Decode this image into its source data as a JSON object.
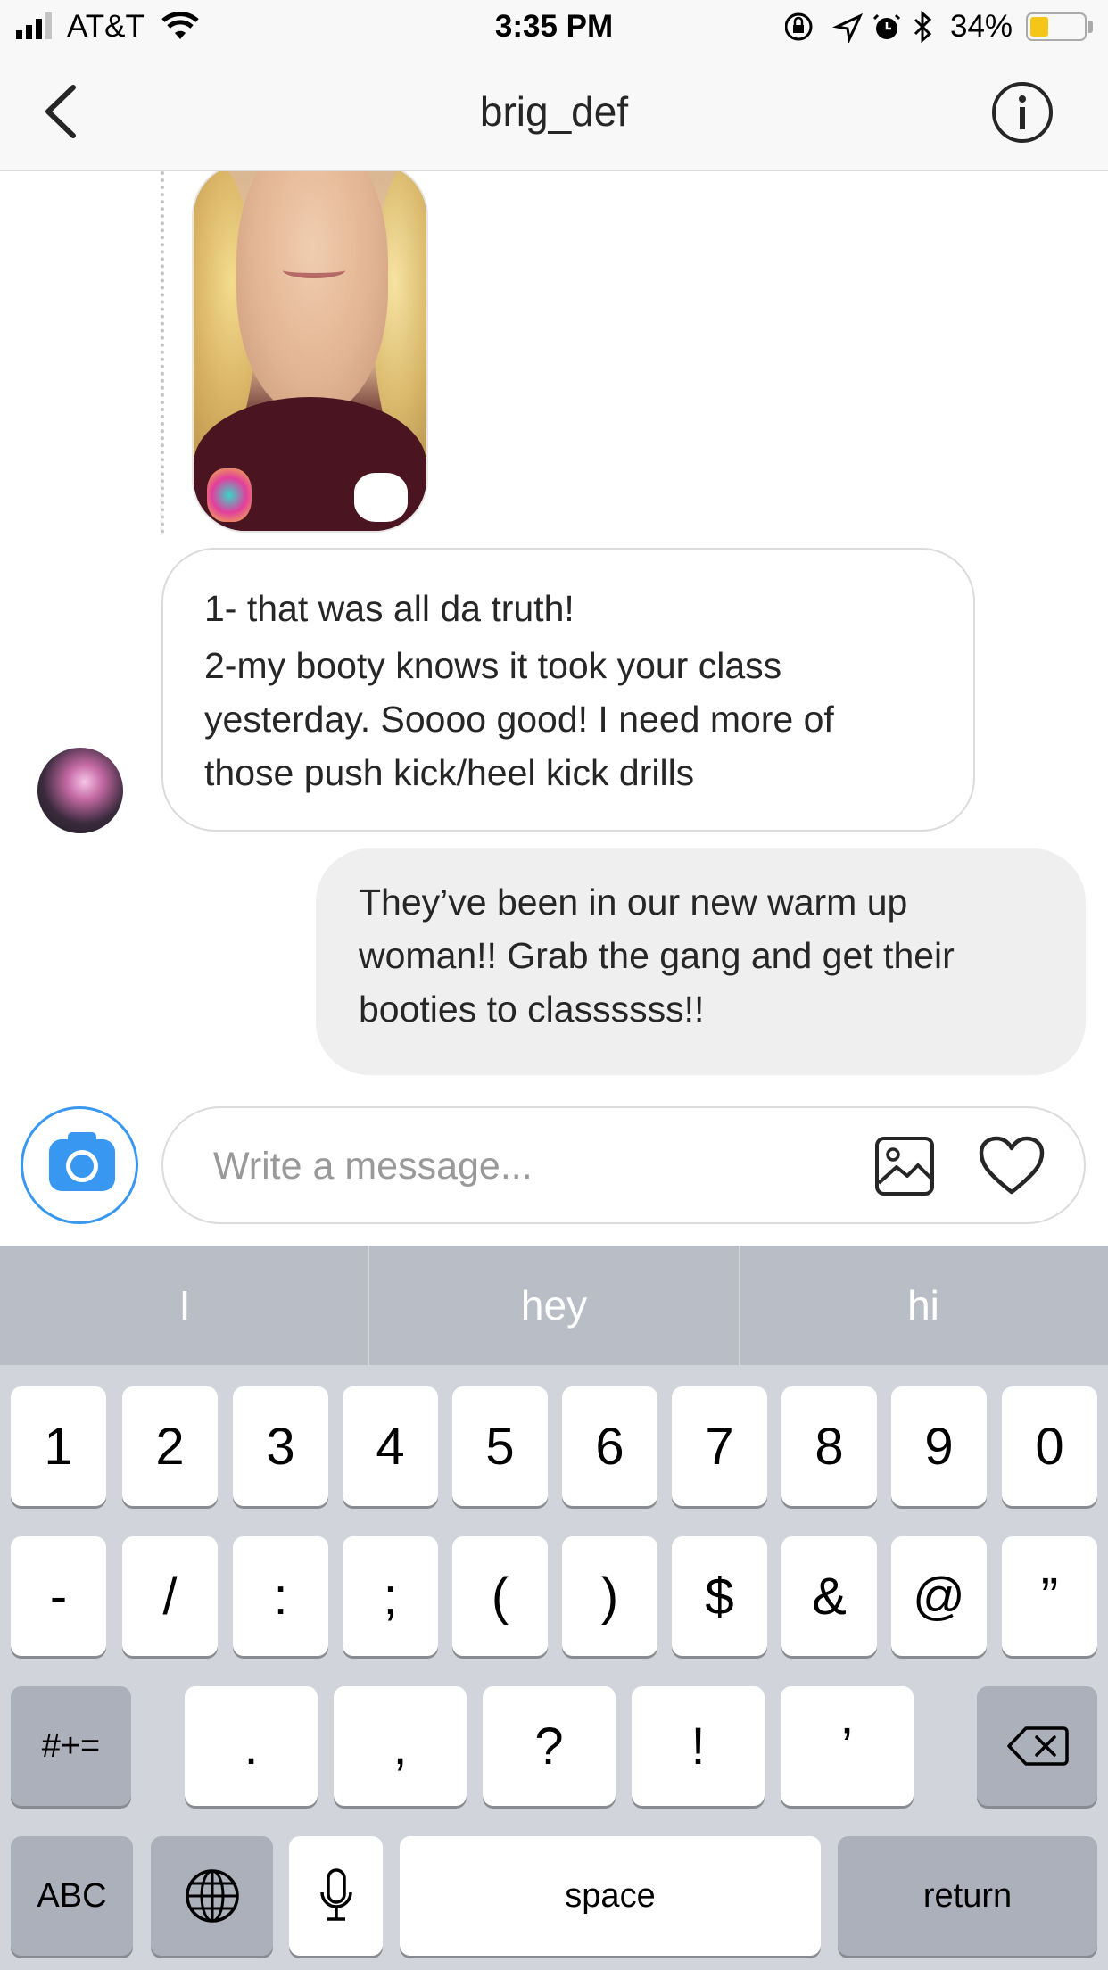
{
  "status_bar": {
    "carrier": "AT&T",
    "time": "3:35 PM",
    "battery_percent": "34%",
    "battery_level": 0.34
  },
  "header": {
    "title": "brig_def",
    "back_icon": "chevron-left-icon",
    "info_icon": "info-circle-icon"
  },
  "messages": {
    "incoming": {
      "line1": "1- that was all da truth!",
      "line2": "2-my booty knows it took your class yesterday. Soooo good!  I need more of those push kick/heel kick drills"
    },
    "outgoing": {
      "text": "They’ve been in our new warm up woman!! Grab the gang and get their booties to classssss!!"
    }
  },
  "composer": {
    "placeholder": "Write a message...",
    "camera_icon": "camera-icon",
    "gallery_icon": "image-icon",
    "heart_icon": "heart-icon",
    "accent_color": "#3897f0"
  },
  "keyboard": {
    "suggestions": [
      "I",
      "hey",
      "hi"
    ],
    "row1": [
      "1",
      "2",
      "3",
      "4",
      "5",
      "6",
      "7",
      "8",
      "9",
      "0"
    ],
    "row2": [
      "-",
      "/",
      ":",
      ";",
      "(",
      ")",
      "$",
      "&",
      "@",
      "”"
    ],
    "row3": [
      ".",
      ",",
      "?",
      "!",
      "’"
    ],
    "symbols_key": "#+=",
    "abc_key": "ABC",
    "space_key": "space",
    "return_key": "return"
  }
}
